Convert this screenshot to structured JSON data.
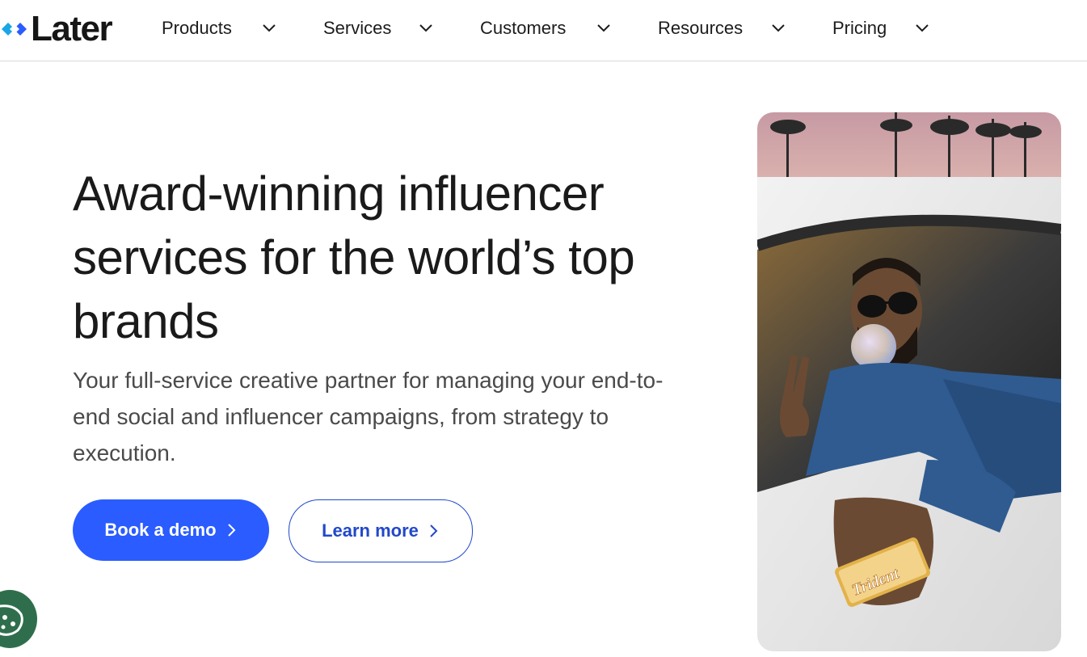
{
  "brand": {
    "name": "Later",
    "logo_icon": "later-diamond-logo-icon",
    "accent": "#2a5cff"
  },
  "nav": {
    "items": [
      {
        "label": "Products",
        "icon": "chevron-down-icon"
      },
      {
        "label": "Services",
        "icon": "chevron-down-icon"
      },
      {
        "label": "Customers",
        "icon": "chevron-down-icon"
      },
      {
        "label": "Resources",
        "icon": "chevron-down-icon"
      },
      {
        "label": "Pricing",
        "icon": "chevron-down-icon"
      }
    ]
  },
  "hero": {
    "title": "Award-winning influencer services for the world’s top brands",
    "subtitle": "Your full-service creative partner for managing your end-to-end social and influencer campaigns, from strategy to execution.",
    "primary_cta": "Book a demo",
    "secondary_cta": "Learn more",
    "image": {
      "subject": "man in sunglasses blowing bubble gum leaning out of a white car window holding a gum pack",
      "pack_text": "Trident"
    }
  },
  "cookie_widget": {
    "icon": "cookie-icon"
  },
  "colors": {
    "primary_button": "#2a5cff",
    "outline_button": "#2248c9",
    "cookie_badge": "#2f6e4c"
  }
}
